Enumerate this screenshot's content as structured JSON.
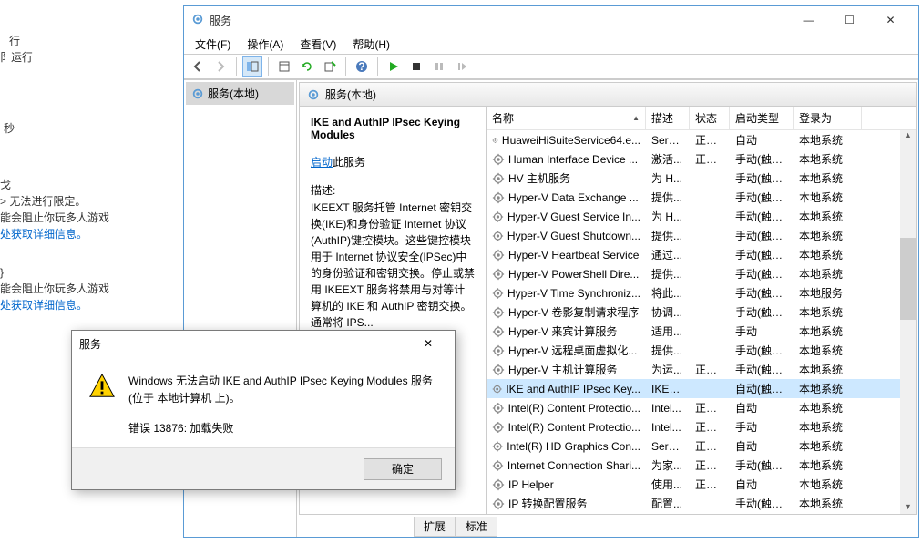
{
  "bg": {
    "l1": "行",
    "l2": "阝运行",
    "l3": "秒",
    "l4": "戈",
    "l5": "> 无法进行限定。",
    "l6": "能会阻止你玩多人游戏",
    "l7": "处获取详细信息。",
    "l8": "}",
    "l9": "能会阻止你玩多人游戏",
    "l10": "处获取详细信息。"
  },
  "window": {
    "title": "服务",
    "menus": {
      "file": "文件(F)",
      "action": "操作(A)",
      "view": "查看(V)",
      "help": "帮助(H)"
    },
    "tree_root": "服务(本地)",
    "pane_title": "服务(本地)",
    "tabs": {
      "extended": "扩展",
      "standard": "标准"
    },
    "win_min": "—",
    "win_max": "☐",
    "win_close": "✕"
  },
  "detail": {
    "name": "IKE and AuthIP IPsec Keying Modules",
    "start_link": "启动",
    "start_suffix": "此服务",
    "desc_label": "描述:",
    "desc_text": "IKEEXT 服务托管 Internet 密钥交换(IKE)和身份验证 Internet 协议(AuthIP)键控模块。这些键控模块用于 Internet 协议安全(IPSec)中的身份验证和密钥交换。停止或禁用 IKEEXT 服务将禁用与对等计算机的 IKE 和 AuthIP 密钥交换。通常将 IPS..."
  },
  "columns": {
    "name": "名称",
    "desc": "描述",
    "status": "状态",
    "startup": "启动类型",
    "logon": "登录为"
  },
  "rows": [
    {
      "name": "HuaweiHiSuiteService64.e...",
      "desc": "Servi...",
      "status": "正在...",
      "startup": "自动",
      "logon": "本地系统"
    },
    {
      "name": "Human Interface Device ...",
      "desc": "激活...",
      "status": "正在...",
      "startup": "手动(触发...",
      "logon": "本地系统"
    },
    {
      "name": "HV 主机服务",
      "desc": "为 H...",
      "status": "",
      "startup": "手动(触发...",
      "logon": "本地系统"
    },
    {
      "name": "Hyper-V Data Exchange ...",
      "desc": "提供...",
      "status": "",
      "startup": "手动(触发...",
      "logon": "本地系统"
    },
    {
      "name": "Hyper-V Guest Service In...",
      "desc": "为 H...",
      "status": "",
      "startup": "手动(触发...",
      "logon": "本地系统"
    },
    {
      "name": "Hyper-V Guest Shutdown...",
      "desc": "提供...",
      "status": "",
      "startup": "手动(触发...",
      "logon": "本地系统"
    },
    {
      "name": "Hyper-V Heartbeat Service",
      "desc": "通过...",
      "status": "",
      "startup": "手动(触发...",
      "logon": "本地系统"
    },
    {
      "name": "Hyper-V PowerShell Dire...",
      "desc": "提供...",
      "status": "",
      "startup": "手动(触发...",
      "logon": "本地系统"
    },
    {
      "name": "Hyper-V Time Synchroniz...",
      "desc": "将此...",
      "status": "",
      "startup": "手动(触发...",
      "logon": "本地服务"
    },
    {
      "name": "Hyper-V 卷影复制请求程序",
      "desc": "协调...",
      "status": "",
      "startup": "手动(触发...",
      "logon": "本地系统"
    },
    {
      "name": "Hyper-V 来宾计算服务",
      "desc": "适用...",
      "status": "",
      "startup": "手动",
      "logon": "本地系统"
    },
    {
      "name": "Hyper-V 远程桌面虚拟化...",
      "desc": "提供...",
      "status": "",
      "startup": "手动(触发...",
      "logon": "本地系统"
    },
    {
      "name": "Hyper-V 主机计算服务",
      "desc": "为运...",
      "status": "正在...",
      "startup": "手动(触发...",
      "logon": "本地系统"
    },
    {
      "name": "IKE and AuthIP IPsec Key...",
      "desc": "IKEE...",
      "status": "",
      "startup": "自动(触发...",
      "logon": "本地系统",
      "selected": true
    },
    {
      "name": "Intel(R) Content Protectio...",
      "desc": "Intel...",
      "status": "正在...",
      "startup": "自动",
      "logon": "本地系统"
    },
    {
      "name": "Intel(R) Content Protectio...",
      "desc": "Intel...",
      "status": "正在...",
      "startup": "手动",
      "logon": "本地系统"
    },
    {
      "name": "Intel(R) HD Graphics Con...",
      "desc": "Servi...",
      "status": "正在...",
      "startup": "自动",
      "logon": "本地系统"
    },
    {
      "name": "Internet Connection Shari...",
      "desc": "为家...",
      "status": "正在...",
      "startup": "手动(触发...",
      "logon": "本地系统"
    },
    {
      "name": "IP Helper",
      "desc": "使用...",
      "status": "正在...",
      "startup": "自动",
      "logon": "本地系统"
    },
    {
      "name": "IP 转换配置服务",
      "desc": "配置...",
      "status": "",
      "startup": "手动(触发...",
      "logon": "本地系统"
    }
  ],
  "dialog": {
    "title": "服务",
    "msg_l1": "Windows 无法启动 IKE and AuthIP IPsec Keying Modules 服务(位于 本地计算机 上)。",
    "msg_l2": "错误 13876: 加载失败",
    "ok": "确定",
    "close": "✕"
  }
}
